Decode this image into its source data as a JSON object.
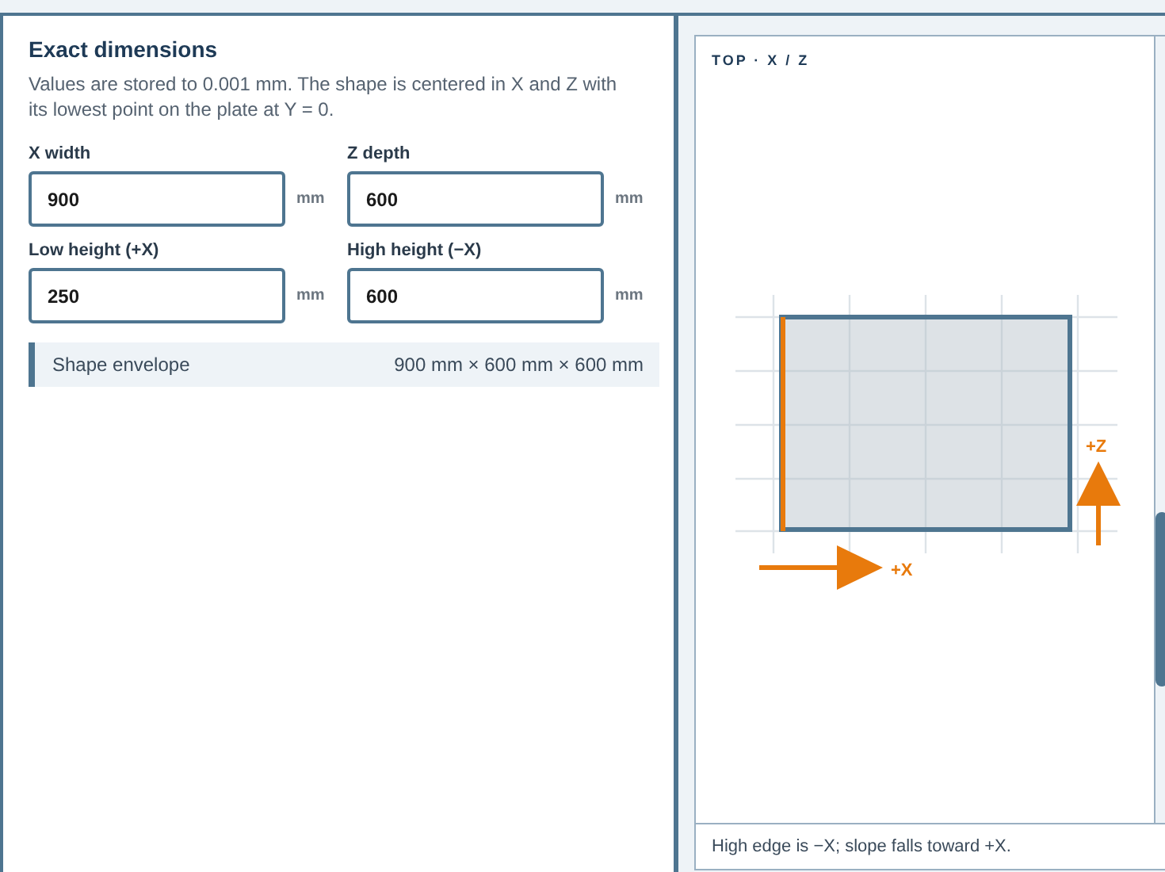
{
  "section": {
    "title": "Exact dimensions",
    "description": "Values are stored to 0.001 mm. The shape is centered in X and Z with its lowest point on the plate at Y = 0."
  },
  "fields": [
    {
      "label": "X width",
      "value": "900",
      "unit": "mm"
    },
    {
      "label": "Z depth",
      "value": "600",
      "unit": "mm"
    },
    {
      "label": "Low height (+X)",
      "value": "250",
      "unit": "mm"
    },
    {
      "label": "High height (−X)",
      "value": "600",
      "unit": "mm"
    }
  ],
  "envelope": {
    "label": "Shape envelope",
    "value": "900 mm × 600 mm × 600 mm"
  },
  "view": {
    "title": "TOP · X / Z",
    "x_axis": "+X",
    "z_axis": "+Z",
    "caption": "High edge is −X; slope falls toward +X."
  }
}
